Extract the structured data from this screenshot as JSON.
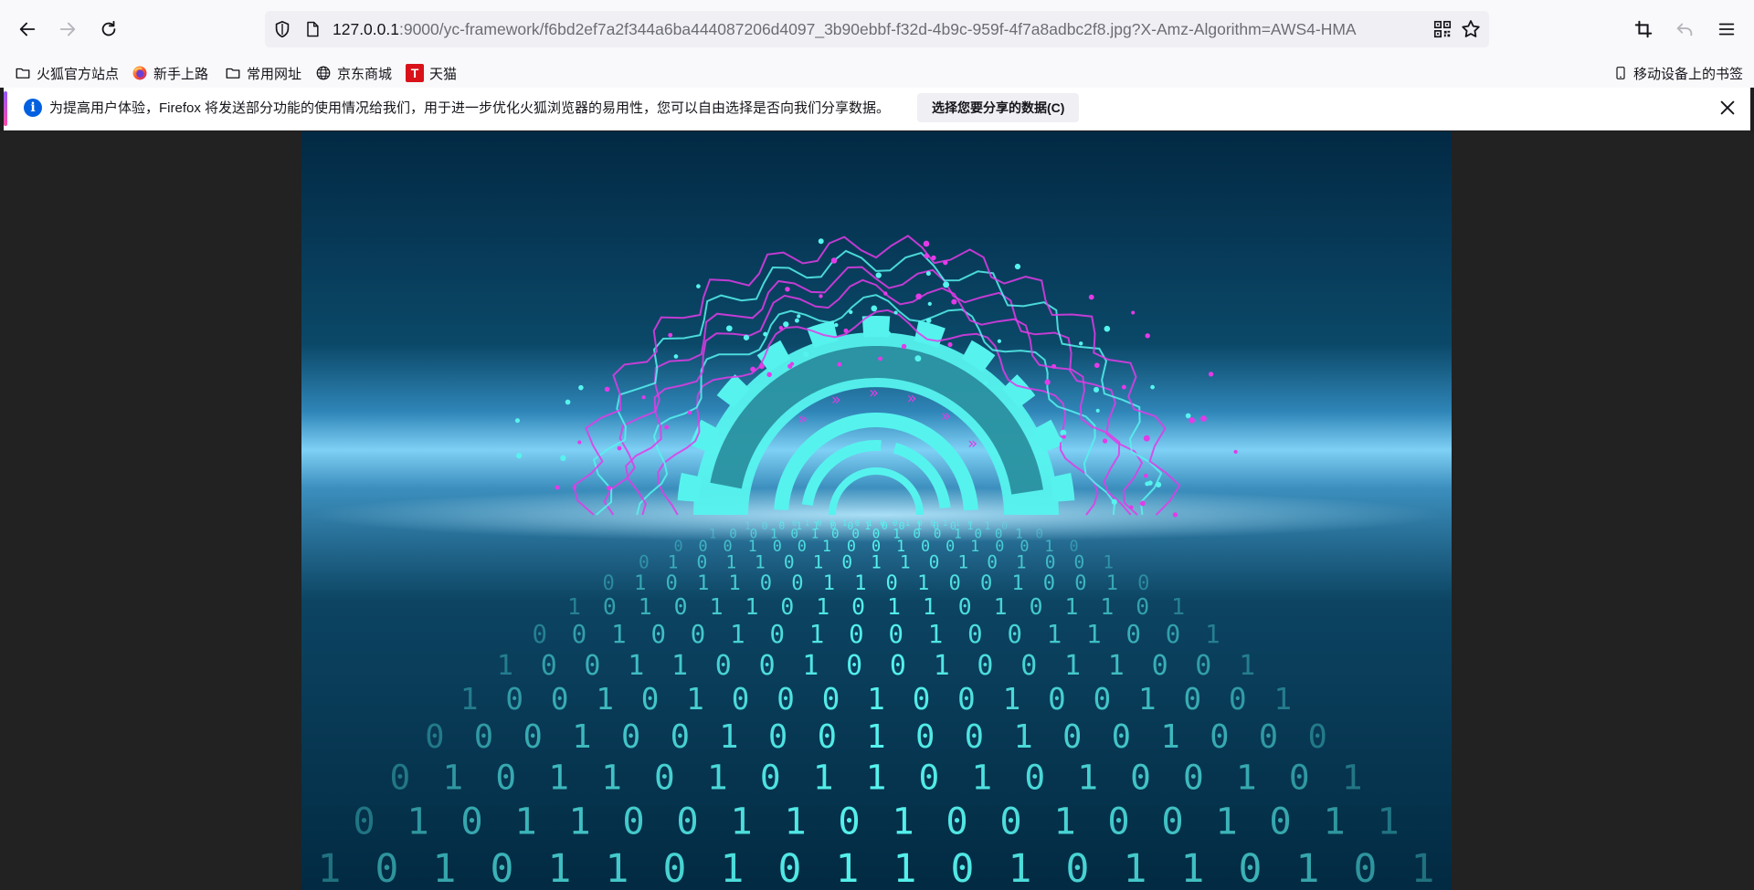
{
  "toolbar": {
    "back_icon": "arrow-left-icon",
    "forward_icon": "arrow-right-icon",
    "reload_icon": "reload-icon",
    "url_host": "127.0.0.1",
    "url_rest": ":9000/yc-framework/f6bd2ef7a2f344a6ba444087206d4097_3b90ebbf-f32d-4b9c-959f-4f7a8adbc2f8.jpg?X-Amz-Algorithm=AWS4-HMA",
    "icons_right": [
      "screenshot-crop-icon",
      "undo-icon",
      "menu-icon"
    ]
  },
  "bookmarks": {
    "items": [
      {
        "label": "火狐官方站点",
        "icon": "folder-icon"
      },
      {
        "label": "新手上路",
        "icon": "firefox-icon"
      },
      {
        "label": "常用网址",
        "icon": "folder-icon"
      },
      {
        "label": "京东商城",
        "icon": "globe-icon"
      },
      {
        "label": "天猫",
        "icon": "tmall-icon",
        "logo_letter": "T"
      }
    ],
    "mobile_label": "移动设备上的书签"
  },
  "notice": {
    "text": "为提高用户体验，Firefox 将发送部分功能的使用情况给我们，用于进一步优化火狐浏览器的易用性，您可以自由选择是否向我们分享数据。",
    "button_label": "选择您要分享的数据(C)",
    "info_glyph": "i"
  },
  "image": {
    "description_icon": "binary-tunnel-image",
    "binary_rows": [
      "0 0 1 0 0 1 0 1 0 0 1 0 0 1 1 0 0 1 0 1",
      "1 0 0 1 1 0 0 1 0 0 1 0 0 1 1 0 0",
      "1 0 0 1 0 1 0 0 0 1 0 0 1 0 0",
      "0 0 0 1 0 0 1 0 0 1 0 0 1 0 0 1",
      "0 1 0 1 1 0 1 0 1 1 0 1 0 1 0",
      "0 1 0 1 1 0 0 1 1 0 1 0 0 1 0",
      "1 0 1 0 1 1 0 1 0 1 1 0 1 0 1"
    ],
    "colors": {
      "sky_top": "#022944",
      "horizon": "#7fd0f5",
      "floor": "#0a3a57",
      "cyan": "#56f3ee",
      "magenta": "#e33be8"
    }
  }
}
